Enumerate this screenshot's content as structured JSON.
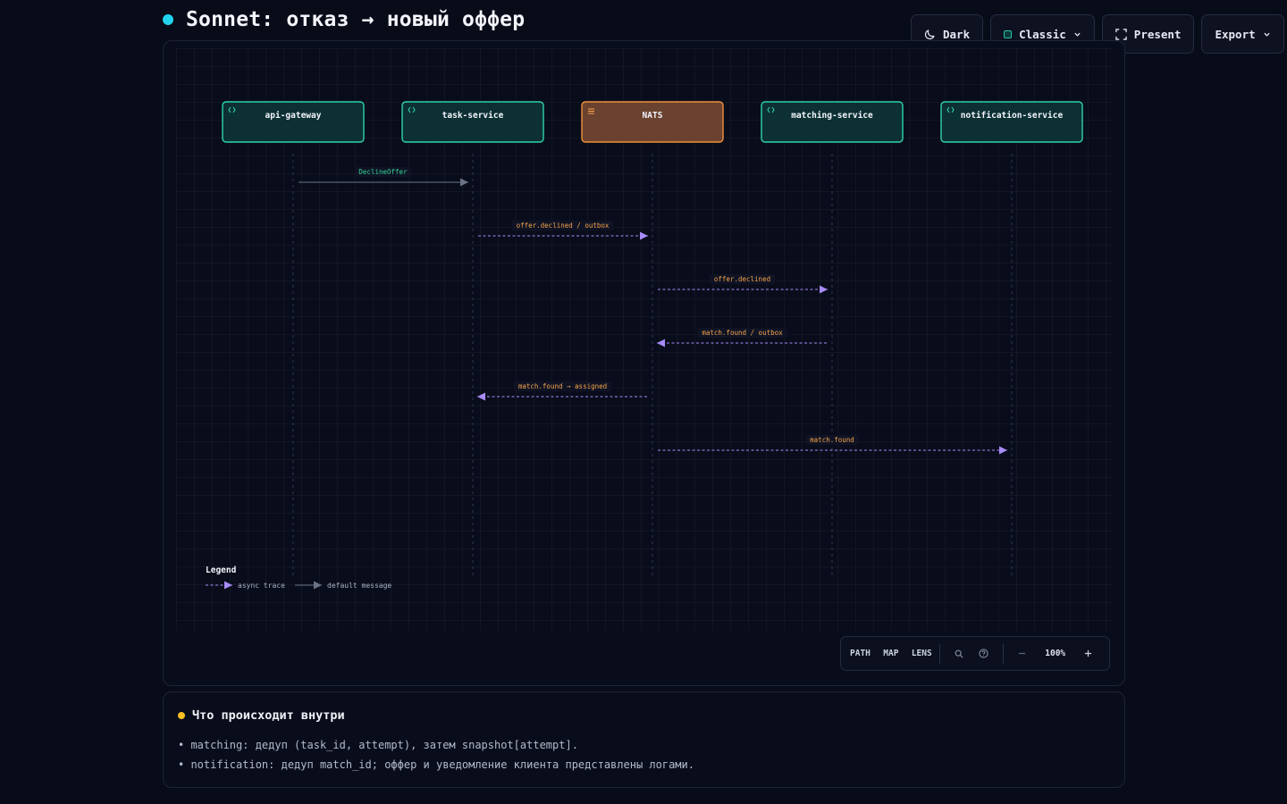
{
  "title": "Sonnet: отказ → новый оффер",
  "toolbar": {
    "dark_label": "Dark",
    "theme_label": "Classic",
    "present_label": "Present",
    "export_label": "Export"
  },
  "colors": {
    "service_border": "#2fd4a8",
    "service_fill": "#0c3034",
    "broker_border": "#f0913a",
    "broker_fill": "#6b4230",
    "async_arrow": "#a78bfa",
    "default_arrow": "#6b7387",
    "async_label": "#f5a34a",
    "default_label": "#34d399"
  },
  "diagram": {
    "participants": [
      {
        "id": "api",
        "label": "api-gateway",
        "kind": "service",
        "icon": "code-brackets-icon"
      },
      {
        "id": "task",
        "label": "task-service",
        "kind": "service",
        "icon": "code-brackets-icon"
      },
      {
        "id": "nats",
        "label": "NATS",
        "kind": "broker",
        "icon": "queue-lines-icon"
      },
      {
        "id": "match",
        "label": "matching-service",
        "kind": "service",
        "icon": "code-brackets-icon"
      },
      {
        "id": "notif",
        "label": "notification-service",
        "kind": "service",
        "icon": "code-brackets-icon"
      }
    ],
    "messages": [
      {
        "from": 0,
        "to": 1,
        "label": "DeclineOffer",
        "style": "default"
      },
      {
        "from": 1,
        "to": 2,
        "label": "offer.declined / outbox",
        "style": "async"
      },
      {
        "from": 2,
        "to": 3,
        "label": "offer.declined",
        "style": "async"
      },
      {
        "from": 3,
        "to": 2,
        "label": "match.found / outbox",
        "style": "async"
      },
      {
        "from": 2,
        "to": 1,
        "label": "match.found → assigned",
        "style": "async"
      },
      {
        "from": 2,
        "to": 4,
        "label": "match.found",
        "style": "async"
      }
    ],
    "legend": {
      "title": "Legend",
      "async_label": "async trace",
      "default_label": "default message"
    }
  },
  "zoombar": {
    "path_label": "PATH",
    "map_label": "MAP",
    "lens_label": "LENS",
    "zoom_level": "100%"
  },
  "notes": {
    "title": "Что происходит внутри",
    "items": [
      "• matching: дедуп (task_id, attempt), затем snapshot[attempt].",
      "• notification: дедуп match_id; оффер и уведомление клиента представлены логами."
    ]
  }
}
